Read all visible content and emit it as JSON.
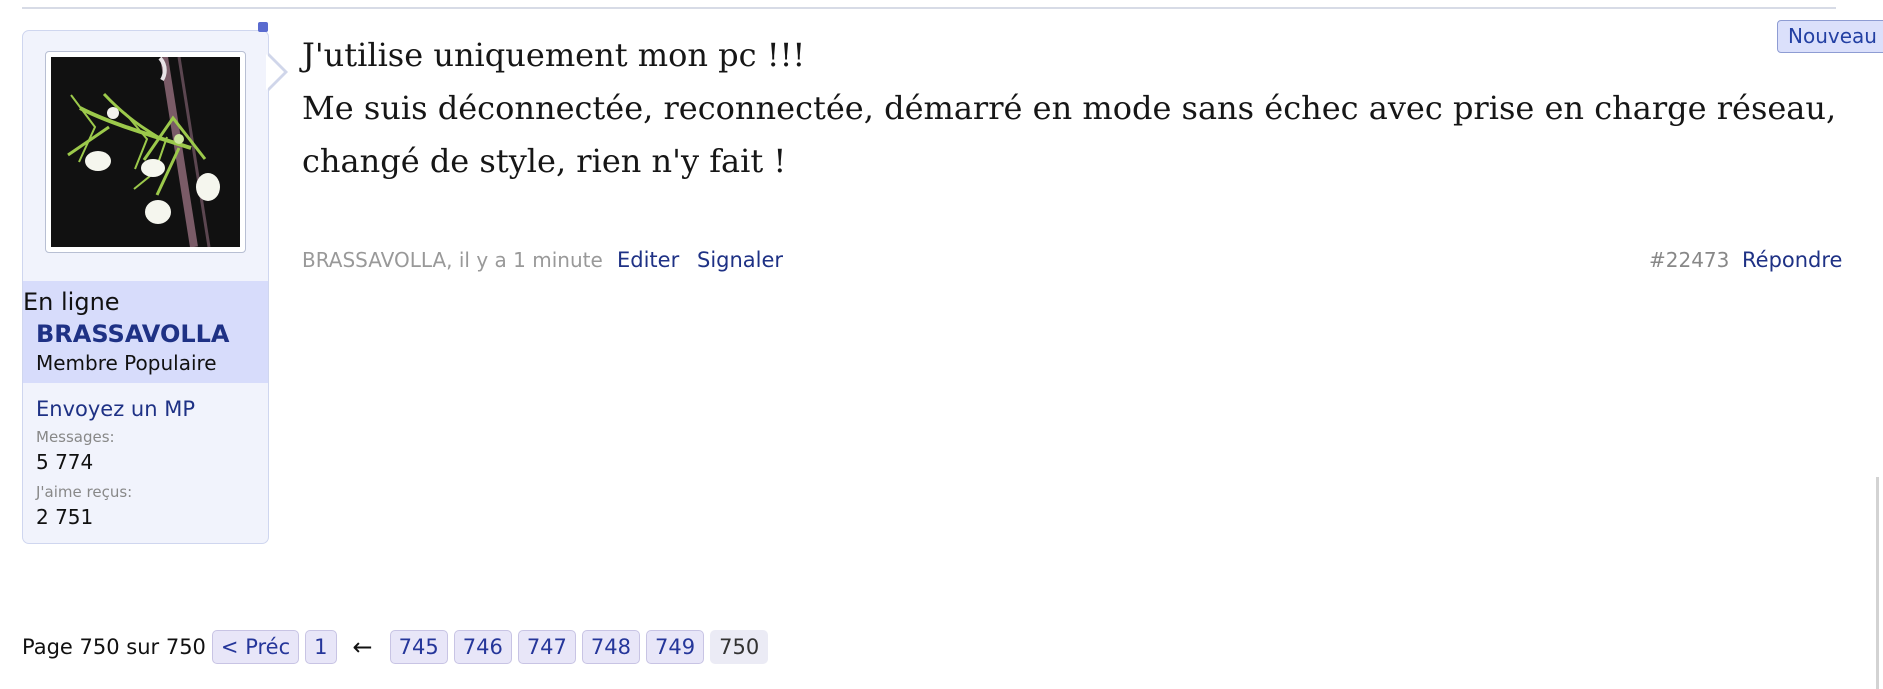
{
  "member": {
    "status": "En ligne",
    "name": "BRASSAVOLLA",
    "role": "Membre Populaire",
    "pm_link": "Envoyez un MP",
    "messages_label": "Messages:",
    "messages_value": "5 774",
    "likes_label": "J'aime reçus:",
    "likes_value": "2 751"
  },
  "post": {
    "lines": [
      "J'utilise uniquement mon pc !!!",
      "Me suis déconnectée, reconnectée, démarré en mode sans échec avec prise en charge réseau,",
      "changé de style, rien n'y fait !"
    ],
    "meta": "BRASSAVOLLA, il y a 1 minute",
    "edit_label": "Editer",
    "report_label": "Signaler",
    "number": "#22473",
    "reply_label": "Répondre",
    "new_tag": "Nouveau"
  },
  "pagination": {
    "label": "Page 750 sur 750",
    "prev": "< Préc",
    "first": "1",
    "ellipsis_arrow": "←",
    "pages": [
      "745",
      "746",
      "747",
      "748",
      "749"
    ],
    "current": "750"
  },
  "colors": {
    "accent": "#1e3185",
    "panel_background": "#f1f3fc",
    "highlight_background": "#d7dcfb"
  },
  "icons": {
    "avatar": "orchid-avatar",
    "bubble": "speech-bubble-pointer"
  }
}
